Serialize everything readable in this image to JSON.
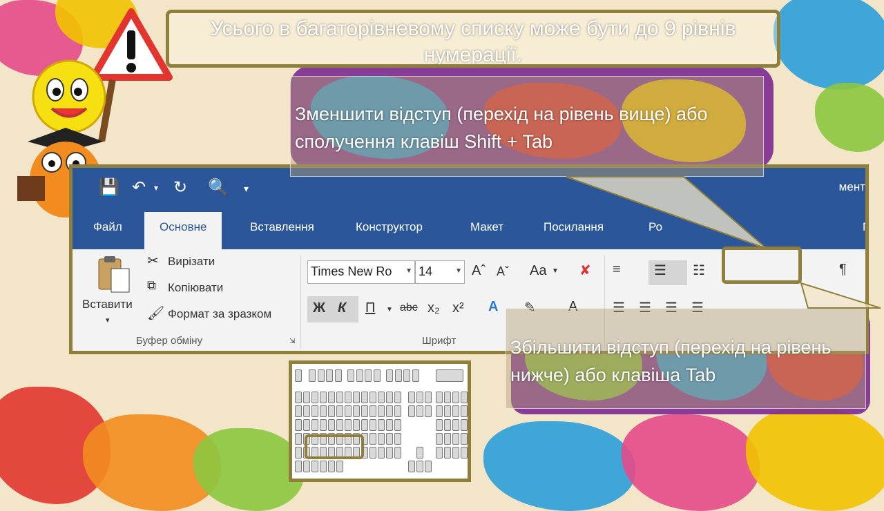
{
  "slide": {
    "title": "Усього в багаторівневому списку може бути до 9 рівнів нумерації.",
    "callout_decrease": "Зменшити відступ (перехід на рівень вище) або сполучення клавіш Shift +  Tab",
    "callout_increase": "Збільшити відступ (перехід на рівень нижче) або клавіша Tab"
  },
  "word": {
    "titlebar_right_text": "мент",
    "tabs": [
      "Файл",
      "Основне",
      "Вставлення",
      "Конструктор",
      "Макет",
      "Посилання",
      "Ро",
      "П"
    ],
    "clipboard": {
      "paste_label": "Вставити",
      "cut_label": "Вирізати",
      "copy_label": "Копіювати",
      "format_painter_label": "Формат за зразком",
      "group_label": "Буфер обміну"
    },
    "font": {
      "font_name": "Times New Ro",
      "font_size": "14",
      "bold": "Ж",
      "italic": "К",
      "underline": "П",
      "strike": "abc",
      "subscript": "x₂",
      "superscript": "x²",
      "group_label": "Шрифт",
      "change_case": "Aa"
    },
    "paragraph": {
      "pilcrow": "¶"
    }
  },
  "colors": {
    "word_blue": "#2b579a",
    "frame_olive": "#8f7f3a"
  }
}
